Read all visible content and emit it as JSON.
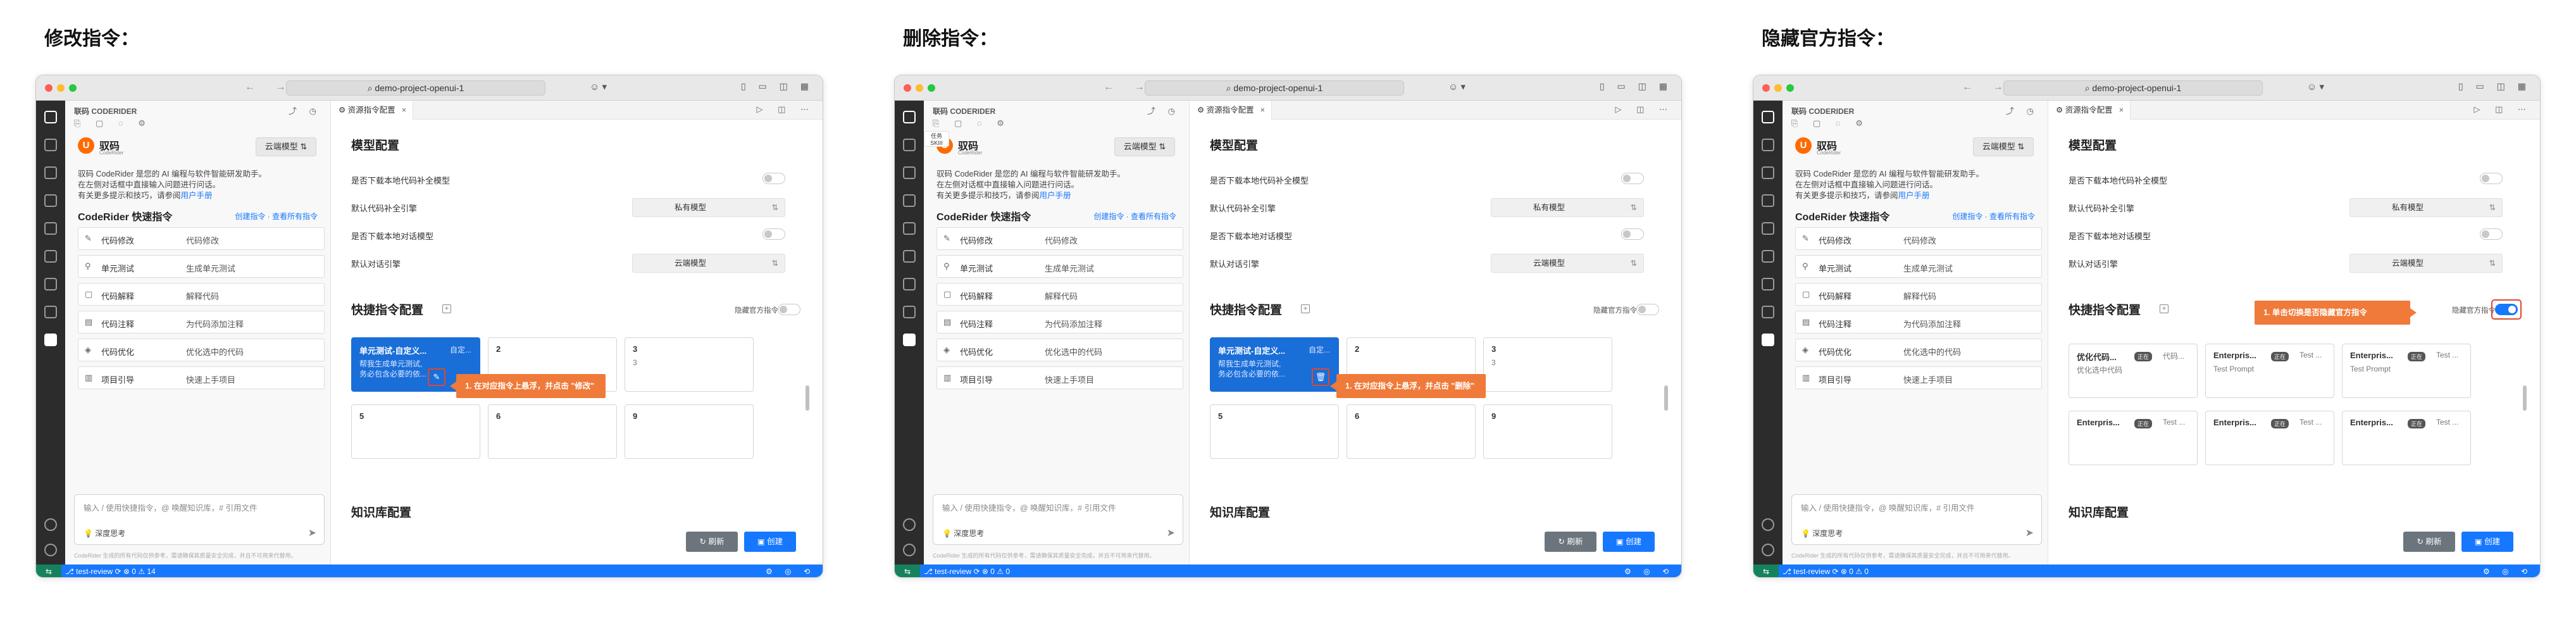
{
  "panels": [
    {
      "title": "修改指令：",
      "variant": "edit",
      "callout": "1. 在对应指令上悬浮，并点击 \"修改\"",
      "edit_icon": "pencil-icon"
    },
    {
      "title": "删除指令：",
      "variant": "delete",
      "callout": "1. 在对应指令上悬浮，并点击 \"删除\"",
      "edit_icon": "trash-icon",
      "tooltip_top": "任务",
      "tooltip_bottom": "SKIII"
    },
    {
      "title": "隐藏官方指令：",
      "variant": "hide",
      "callout": "1. 单击切换是否隐藏官方指令"
    }
  ],
  "window": {
    "nav_arrows": "← →",
    "command_center": "⌕ demo-project-openui-1",
    "account": "☺ ▾",
    "titlebar_icons": "▯ ▭ ◫ ▦"
  },
  "sidebar": {
    "header": "联码 CODERIDER",
    "header_icons": "⤴ ◷",
    "tools": "⎘ ▢ ◌ ⚙",
    "logo_letter": "U",
    "brand": "驭码",
    "brand_sub": "CodeRider",
    "model_select": "云端模型 ⇅",
    "intro_line1": "驭码 CodeRider 是您的 AI 编程与软件智能研发助手。",
    "intro_line2": "在左侧对话框中直接输入问题进行问话。",
    "intro_line3_prefix": "有关更多提示和技巧，请参阅",
    "intro_link": "用户手册",
    "quick_title": "CodeRider 快速指令",
    "quick_links": "创建指令 · 查看所有指令",
    "quick_commands": [
      {
        "icon": "✎",
        "name": "代码修改",
        "desc": "代码修改"
      },
      {
        "icon": "⚲",
        "name": "单元测试",
        "desc": "生成单元测试"
      },
      {
        "icon": "▢",
        "name": "代码解释",
        "desc": "解释代码"
      },
      {
        "icon": "▤",
        "name": "代码注释",
        "desc": "为代码添加注释"
      },
      {
        "icon": "◈",
        "name": "代码优化",
        "desc": "优化选中的代码"
      },
      {
        "icon": "▥",
        "name": "项目引导",
        "desc": "快速上手项目"
      }
    ],
    "chat_placeholder": "输入 / 使用快捷指令，@ 唤醒知识库，# 引用文件",
    "deep_think": "💡 深度思考",
    "send": "➤",
    "disclaimer": "CodeRider 生成的所有代码仅供参考，需请确保其质量安全完成，并且不可用来代替用。"
  },
  "editor": {
    "tab_label": "⚙ 资源指令配置",
    "tab_close": "×",
    "tab_icons": "▷ ◫ ⋯",
    "model_section": "模型配置",
    "rows": [
      {
        "label": "是否下载本地代码补全模型"
      },
      {
        "label": "默认代码补全引擎",
        "select": "私有模型"
      },
      {
        "label": "是否下载本地对话模型"
      },
      {
        "label": "默认对话引擎",
        "select": "云端模型"
      }
    ],
    "select_caret": "⇅",
    "quick_section": "快捷指令配置",
    "hide_official": "隐藏官方指令",
    "custom_cards": [
      {
        "title": "单元测试-自定义...",
        "tag": "自定...",
        "line1": "帮我生成单元测试,",
        "line2": "务必包含必要的依..."
      },
      {
        "title": "2",
        "line1": "",
        "line2": ""
      },
      {
        "title": "3",
        "line1": "3",
        "line2": ""
      },
      {
        "title": "5",
        "line1": "",
        "line2": ""
      },
      {
        "title": "6",
        "line1": "",
        "line2": ""
      },
      {
        "title": "9",
        "line1": "",
        "line2": ""
      }
    ],
    "official_cards": [
      {
        "title": "优化代码...",
        "badge": "正在",
        "tp": "代码...",
        "line1": "优化选中代码"
      },
      {
        "title": "Enterpris...",
        "badge": "正在",
        "tp": "Test ...",
        "line1": "Test Prompt"
      },
      {
        "title": "Enterpris...",
        "badge": "正在",
        "tp": "Test ...",
        "line1": "Test Prompt"
      },
      {
        "title": "Enterpris...",
        "badge": "正在",
        "tp": "Test ...",
        "line1": ""
      },
      {
        "title": "Enterpris...",
        "badge": "正在",
        "tp": "Test ...",
        "line1": ""
      },
      {
        "title": "Enterpris...",
        "badge": "正在",
        "tp": "Test ...",
        "line1": ""
      }
    ],
    "plus": "+",
    "kb_section": "知识库配置",
    "refresh": "↻ 刷新",
    "create": "▣ 创建"
  },
  "statusbar": {
    "remote": "⇆",
    "branch": "⎇ test-review ⟳  ⊗ 0 ⚠ 14",
    "branch_alt": "⎇ test-review ⟳  ⊗ 0 ⚠ 0",
    "right": "⚙ ◎ ⟲"
  },
  "colors": {
    "accent": "#1677ff",
    "callout": "#ef7a39",
    "highlight": "#e0472d",
    "activity_bar": "#2c2c2c"
  }
}
